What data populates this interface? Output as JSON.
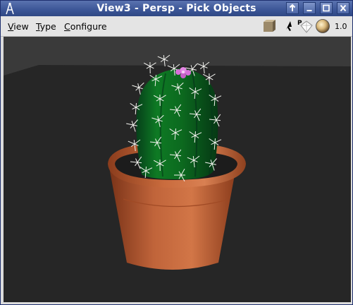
{
  "window": {
    "title": "View3 - Persp - Pick Objects",
    "buttons": [
      "raise",
      "minimize",
      "maximize",
      "close"
    ]
  },
  "menu": {
    "items": [
      {
        "label": "View",
        "mnemonic": "V",
        "rest": "iew"
      },
      {
        "label": "Type",
        "mnemonic": "T",
        "rest": "ype"
      },
      {
        "label": "Configure",
        "mnemonic": "C",
        "rest": "onfigure"
      }
    ]
  },
  "toolbar": {
    "tools": [
      "cube-shade-icon",
      "arrow-pick-icon",
      "perspective-icon",
      "sphere-light-icon"
    ],
    "zoom": "1.0"
  },
  "viewport": {
    "scene": "cactus in terracotta pot",
    "colors": {
      "background": "#3a3a3a",
      "floor": "#272727",
      "pot": "#b25a35",
      "cactus": "#0b6a1a",
      "flower": "#e07ae0"
    }
  }
}
